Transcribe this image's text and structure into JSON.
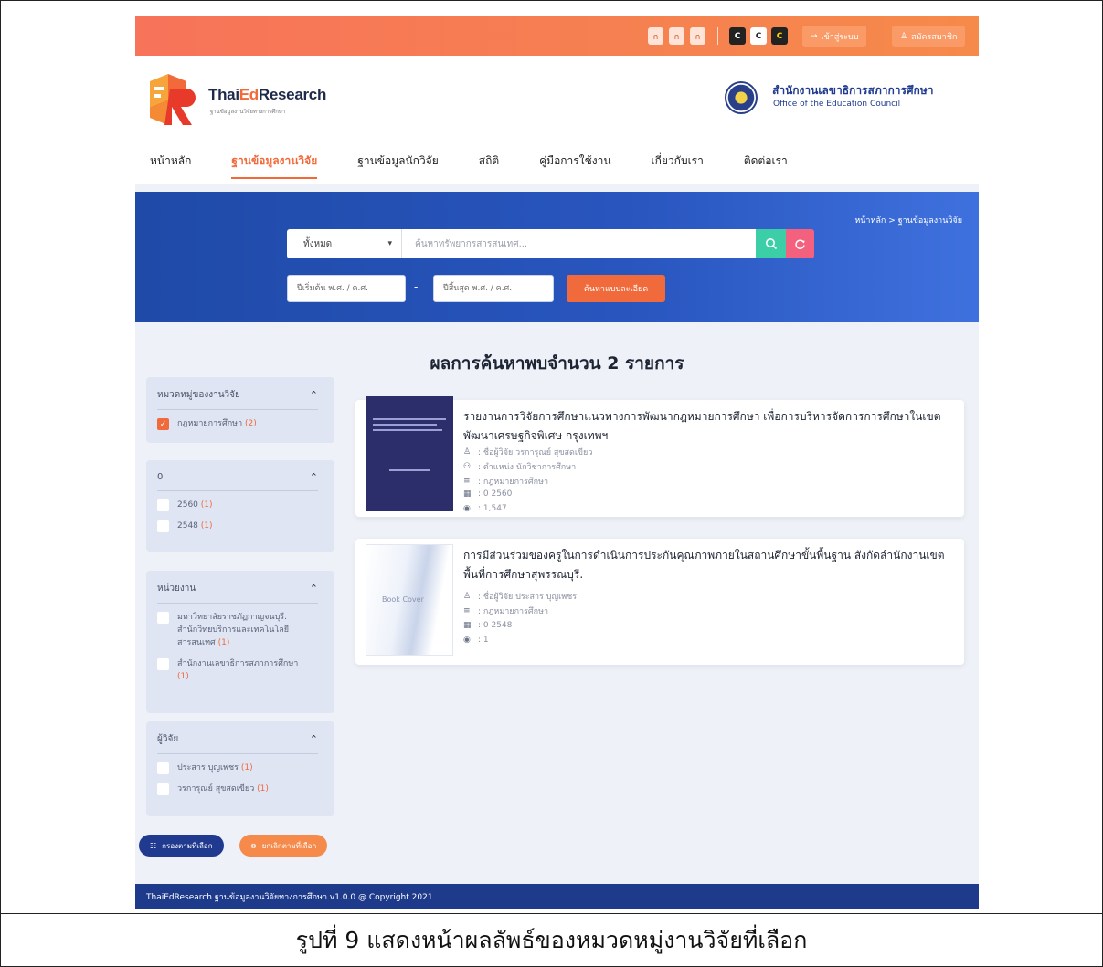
{
  "topbar": {
    "font_sizes": [
      "ก",
      "ก",
      "ก"
    ],
    "contrast_modes": [
      "C",
      "C",
      "C"
    ],
    "login_label": "เข้าสู่ระบบ",
    "register_label": "สมัครสมาชิก"
  },
  "header": {
    "logo_prefix": "Thai",
    "logo_ed": "Ed",
    "logo_suffix": "Research",
    "logo_sub": "ฐานข้อมูลงานวิจัยทางการศึกษา",
    "council_th": "สำนักงานเลขาธิการสภาการศึกษา",
    "council_en": "Office of the Education Council"
  },
  "nav": [
    {
      "label": "หน้าหลัก",
      "active": false
    },
    {
      "label": "ฐานข้อมูลงานวิจัย",
      "active": true
    },
    {
      "label": "ฐานข้อมูลนักวิจัย",
      "active": false
    },
    {
      "label": "สถิติ",
      "active": false
    },
    {
      "label": "คู่มือการใช้งาน",
      "active": false
    },
    {
      "label": "เกี่ยวกับเรา",
      "active": false
    },
    {
      "label": "ติดต่อเรา",
      "active": false
    }
  ],
  "hero": {
    "breadcrumb": "หน้าหลัก > ฐานข้อมูลงานวิจัย",
    "category_value": "ทั้งหมด",
    "search_placeholder": "ค้นหาทรัพยากรสารสนเทศ...",
    "year_start_placeholder": "ปีเริ่มต้น พ.ศ. / ค.ศ.",
    "year_end_placeholder": "ปีสิ้นสุด พ.ศ. / ค.ศ.",
    "advanced_label": "ค้นหาแบบละเอียด"
  },
  "results_title": "ผลการค้นหาพบจำนวน 2 รายการ",
  "filters": [
    {
      "title": "หมวดหมู่ของงานวิจัย",
      "options": [
        {
          "label": "กฎหมายการศึกษา",
          "count": "(2)",
          "checked": true
        }
      ]
    },
    {
      "title": "0",
      "options": [
        {
          "label": "2560",
          "count": "(1)",
          "checked": false
        },
        {
          "label": "2548",
          "count": "(1)",
          "checked": false
        }
      ]
    },
    {
      "title": "หน่วยงาน",
      "options": [
        {
          "label": "มหาวิทยาลัยราชภัฏกาญจนบุรี. สำนักวิทยบริการและเทคโนโลยีสารสนเทศ",
          "count": "(1)",
          "checked": false
        },
        {
          "label": "สำนักงานเลขาธิการสภาการศึกษา",
          "count": "(1)",
          "checked": false
        }
      ]
    },
    {
      "title": "ผู้วิจัย",
      "options": [
        {
          "label": "ประสาร บุญเพชร",
          "count": "(1)",
          "checked": false
        },
        {
          "label": "วรการุณย์ สุขสดเขียว",
          "count": "(1)",
          "checked": false
        }
      ]
    }
  ],
  "filter_buttons": {
    "apply_label": "กรองตามที่เลือก",
    "clear_label": "ยกเลิกตามที่เลือก"
  },
  "results": [
    {
      "title": "รายงานการวิจัยการศึกษาแนวทางการพัฒนากฎหมายการศึกษา เพื่อการบริหารจัดการการศึกษาในเขตพัฒนาเศรษฐกิจพิเศษ กรุงเทพฯ",
      "researcher": ": ชื่อผู้วิจัย วรการุณย์ สุขสดเขียว",
      "position": ": ตำแหน่ง นักวิชาการศึกษา",
      "category": ": กฎหมายการศึกษา",
      "year": ": 0 2560",
      "views": ": 1,547"
    },
    {
      "title": "การมีส่วนร่วมของครูในการดำเนินการประกันคุณภาพภายในสถานศึกษาขั้นพื้นฐาน สังกัดสำนักงานเขตพื้นที่การศึกษาสุพรรณบุรี.",
      "researcher": ": ชื่อผู้วิจัย ประสาร บุญเพชร",
      "category": ": กฎหมายการศึกษา",
      "year": ": 0 2548",
      "views": ": 1",
      "cover_label": "Book Cover"
    }
  ],
  "footer": "ThaiEdResearch ฐานข้อมูลงานวิจัยทางการศึกษา v1.0.0 @ Copyright 2021",
  "caption": "รูปที่ 9 แสดงหน้าผลลัพธ์ของหมวดหมู่งานวิจัยที่เลือก",
  "colors": {
    "accent": "#f26a3a",
    "navy": "#1e3a8a",
    "hero": "#2956bf"
  }
}
